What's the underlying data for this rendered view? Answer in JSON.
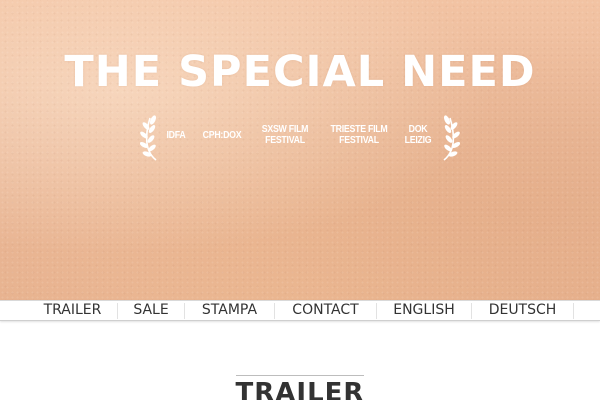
{
  "hero": {
    "title": "THE SPECIAL NEED",
    "festivals": [
      {
        "line1": "IDFA",
        "line2": ""
      },
      {
        "line1": "CPH:DOX",
        "line2": ""
      },
      {
        "line1": "SXSW FILM",
        "line2": "FESTIVAL"
      },
      {
        "line1": "TRIESTE FILM",
        "line2": "FESTIVAL"
      },
      {
        "line1": "DOK",
        "line2": "LEIZIG"
      }
    ],
    "laurel_icon": "laurel-wreath-icon",
    "background_color": "#eab898",
    "text_color": "#ffffff"
  },
  "nav": {
    "items": [
      {
        "label": "TRAILER"
      },
      {
        "label": "SALE"
      },
      {
        "label": "STAMPA"
      },
      {
        "label": "CONTACT"
      },
      {
        "label": "ENGLISH"
      },
      {
        "label": "DEUTSCH"
      }
    ]
  },
  "main": {
    "section_title": "TRAILER"
  }
}
